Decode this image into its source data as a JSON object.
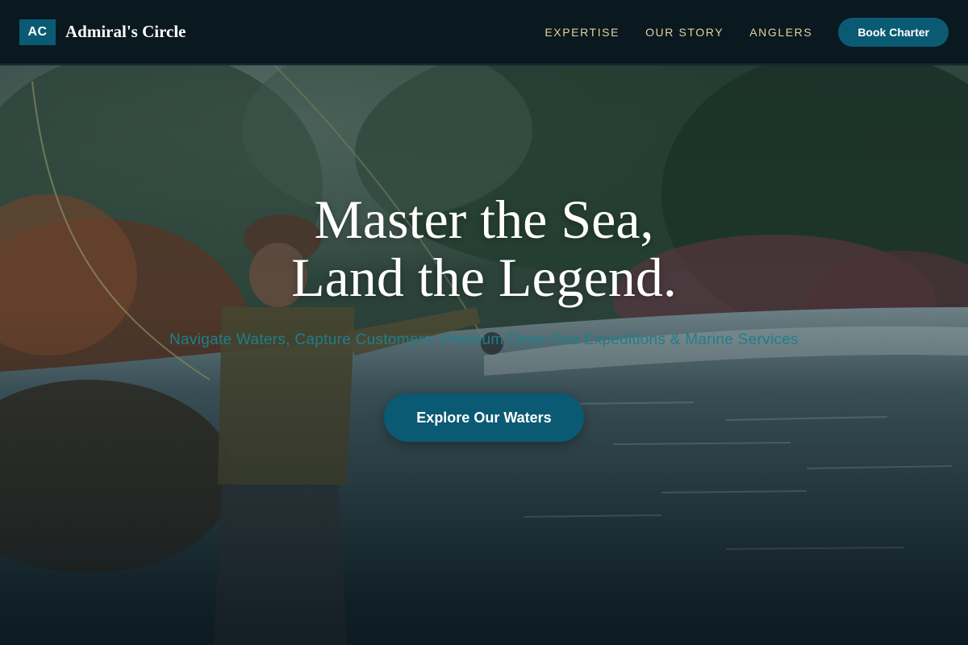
{
  "nav": {
    "brand_mark": "AC",
    "brand_name": "Admiral's Circle",
    "links": [
      {
        "label": "EXPERTISE"
      },
      {
        "label": "OUR STORY"
      },
      {
        "label": "ANGLERS"
      }
    ],
    "cta_label": "Book Charter"
  },
  "hero": {
    "title_line1": "Master the Sea,",
    "title_line2": "Land the Legend.",
    "subtitle": "Navigate Waters, Capture Customers: Premium Deep-Sea Expeditions & Marine Services",
    "button_label": "Explore Our Waters"
  },
  "colors": {
    "accent": "#0b5a73",
    "nav_link": "#e0d49c",
    "subtitle": "#1e7f8c",
    "nav_bg": "#0a1820"
  }
}
